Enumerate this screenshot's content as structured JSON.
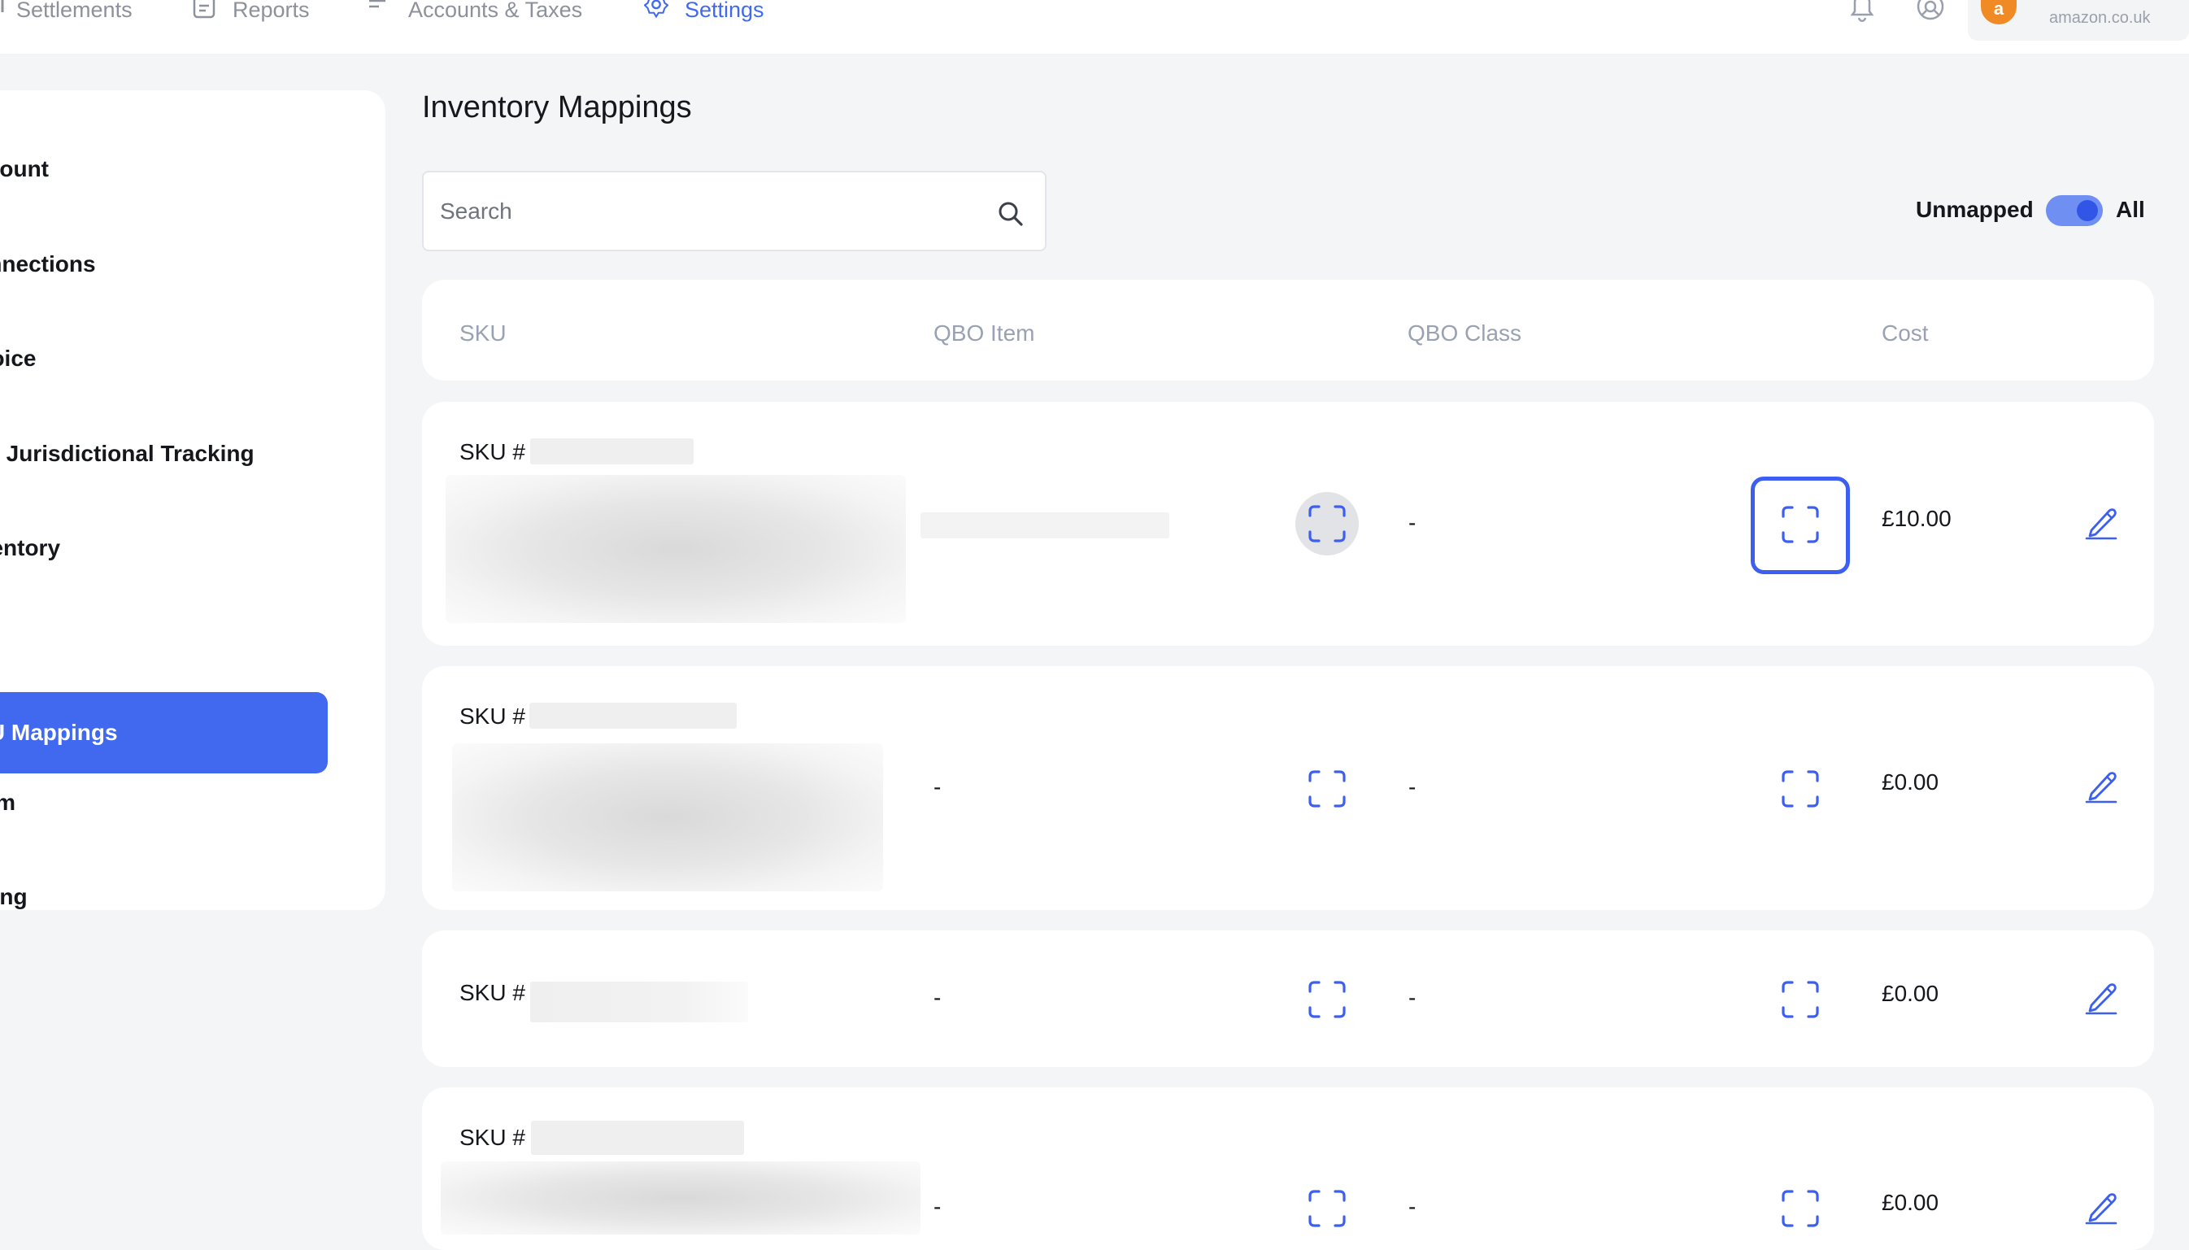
{
  "nav": {
    "items": [
      {
        "label": "Settlements",
        "icon": "settlements-icon"
      },
      {
        "label": "Reports",
        "icon": "report-icon"
      },
      {
        "label": "Accounts & Taxes",
        "icon": "list-icon"
      },
      {
        "label": "Settings",
        "icon": "gear-icon",
        "active": true
      }
    ],
    "account_domain": "amazon.co.uk",
    "logo_letter": "a"
  },
  "sidebar": {
    "items": [
      {
        "label": "Account"
      },
      {
        "label": "Connections"
      },
      {
        "label": "Invoice"
      },
      {
        "label": "VAT Jurisdictional Tracking"
      },
      {
        "label": "Inventory"
      },
      {
        "label": "SKU Mappings",
        "active": true
      },
      {
        "label": "Team"
      },
      {
        "label": "Billing"
      }
    ]
  },
  "main": {
    "title": "Inventory Mappings",
    "search": {
      "placeholder": "Search",
      "value": ""
    },
    "filter": {
      "left_label": "Unmapped",
      "right_label": "All",
      "selected": "All"
    },
    "columns": [
      "SKU",
      "QBO Item",
      "QBO Class",
      "Cost"
    ],
    "rows": [
      {
        "sku_prefix": "SKU #",
        "qbo_item": "",
        "qbo_class": "-",
        "cost": "£10.00"
      },
      {
        "sku_prefix": "SKU #",
        "qbo_item": "-",
        "qbo_class": "-",
        "cost": "£0.00"
      },
      {
        "sku_prefix": "SKU #",
        "qbo_item": "-",
        "qbo_class": "-",
        "cost": "£0.00"
      },
      {
        "sku_prefix": "SKU #",
        "qbo_item": "-",
        "qbo_class": "-",
        "cost": "£0.00"
      }
    ]
  },
  "colors": {
    "accent": "#4169ef",
    "muted": "#9aa1b1",
    "background": "#f4f5f7"
  }
}
